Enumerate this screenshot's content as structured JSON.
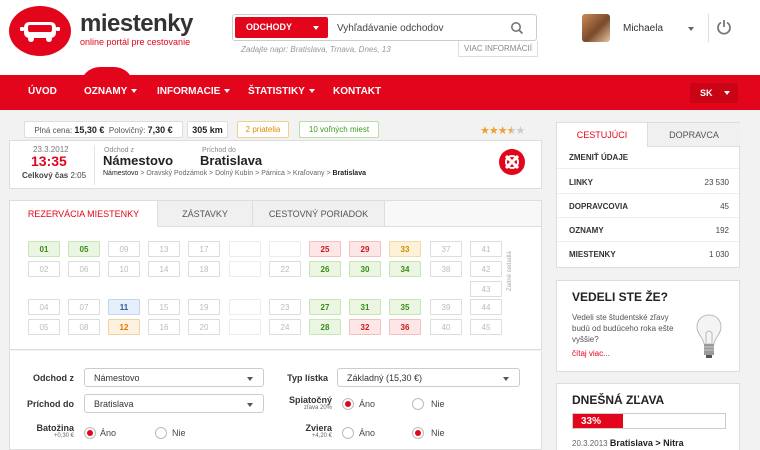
{
  "brand": {
    "name": "miestenky",
    "tagline": "online portál pre cestovanie"
  },
  "search": {
    "mode": "ODCHODY",
    "placeholder": "Vyhľadávanie odchodov",
    "hint": "Zadajte napr: Bratislava, Trnava, Dnes, 13",
    "more_info": "VIAC INFORMÁCIÍ"
  },
  "user": {
    "name": "Michaela"
  },
  "nav": {
    "items": [
      {
        "label": "ÚVOD",
        "dropdown": false
      },
      {
        "label": "OZNAMY",
        "dropdown": true
      },
      {
        "label": "INFORMACIE",
        "dropdown": true
      },
      {
        "label": "ŠTATISTIKY",
        "dropdown": true
      },
      {
        "label": "KONTAKT",
        "dropdown": false
      }
    ],
    "language": "SK"
  },
  "trip": {
    "full_price_label": "Plná cena:",
    "full_price": "15,30 €",
    "half_price_label": "Polovičný:",
    "half_price": "7,30 €",
    "distance": "305 km",
    "friends": "2 priatelia",
    "free_seats": "10 voľných miest",
    "rating": 3.5,
    "date": "23.3.2012",
    "time": "13:35",
    "duration_label": "Celkový čas",
    "duration": "2:05",
    "from_label": "Odchod z",
    "from": "Námestovo",
    "to_label": "Príchod do",
    "to": "Bratislava",
    "route_stops": [
      "Námestovo",
      "Oravský Podzámok",
      "Dolný Kubín",
      "Párnica",
      "Kraľovany"
    ],
    "route_final": "Bratislava"
  },
  "tabs": [
    "REZERVÁCIA MIESTENKY",
    "ZÁSTAVKY",
    "CESTOVNÝ PORIADOK"
  ],
  "seats": {
    "back_label": "Zadné sedadlá",
    "rows": [
      [
        [
          "01",
          "g"
        ],
        [
          "05",
          "g"
        ],
        [
          "09",
          "n"
        ],
        [
          "13",
          "n"
        ],
        [
          "17",
          "n"
        ],
        [
          "",
          ""
        ],
        [
          "",
          ""
        ],
        [
          "25",
          "r"
        ],
        [
          "29",
          "r"
        ],
        [
          "33",
          "y"
        ],
        [
          "37",
          "n"
        ],
        [
          "41",
          "n"
        ]
      ],
      [
        [
          "02",
          "n"
        ],
        [
          "06",
          "n"
        ],
        [
          "10",
          "n"
        ],
        [
          "14",
          "n"
        ],
        [
          "18",
          "n"
        ],
        [
          "",
          ""
        ],
        [
          "22",
          "n"
        ],
        [
          "26",
          "g"
        ],
        [
          "30",
          "g"
        ],
        [
          "34",
          "g"
        ],
        [
          "38",
          "n"
        ],
        [
          "42",
          "n"
        ]
      ],
      [
        [
          "",
          "e"
        ],
        [
          "",
          "e"
        ],
        [
          "",
          "e"
        ],
        [
          "",
          "e"
        ],
        [
          "",
          "e"
        ],
        [
          "",
          "e"
        ],
        [
          "",
          "e"
        ],
        [
          "",
          "e"
        ],
        [
          "",
          "e"
        ],
        [
          "",
          "e"
        ],
        [
          "",
          "e"
        ],
        [
          "43",
          "n"
        ]
      ],
      [
        [
          "04",
          "n"
        ],
        [
          "07",
          "n"
        ],
        [
          "11",
          "b"
        ],
        [
          "15",
          "n"
        ],
        [
          "19",
          "n"
        ],
        [
          "",
          ""
        ],
        [
          "23",
          "n"
        ],
        [
          "27",
          "g"
        ],
        [
          "31",
          "g"
        ],
        [
          "35",
          "g"
        ],
        [
          "39",
          "n"
        ],
        [
          "44",
          "n"
        ]
      ],
      [
        [
          "05",
          "n"
        ],
        [
          "08",
          "n"
        ],
        [
          "12",
          "o"
        ],
        [
          "16",
          "n"
        ],
        [
          "20",
          "n"
        ],
        [
          "",
          ""
        ],
        [
          "24",
          "n"
        ],
        [
          "28",
          "g"
        ],
        [
          "32",
          "r"
        ],
        [
          "36",
          "r"
        ],
        [
          "40",
          "n"
        ],
        [
          "45",
          "n"
        ]
      ]
    ]
  },
  "form": {
    "from_label": "Odchod z",
    "from_value": "Námestovo",
    "to_label": "Príchod do",
    "to_value": "Bratislava",
    "ticket_label": "Typ lístka",
    "ticket_value": "Základný (15,30 €)",
    "student_label": "Spiatočný",
    "student_sub": "zľava 20%",
    "luggage_label": "Batožina",
    "luggage_sub": "+0,30 €",
    "pet_label": "Zviera",
    "pet_sub": "+4,20 €",
    "yes": "Áno",
    "no": "Nie"
  },
  "sidebar": {
    "tabs": [
      "CESTUJÚCI",
      "DOPRAVCA"
    ],
    "stats_title": "ZMENIŤ ÚDAJE",
    "stats": [
      {
        "k": "LINKY",
        "v": "23 530"
      },
      {
        "k": "DOPRAVCOVIA",
        "v": "45"
      },
      {
        "k": "OZNAMY",
        "v": "192"
      },
      {
        "k": "MIESTENKY",
        "v": "1 030"
      }
    ],
    "tip_title": "VEDELI STE ŽE?",
    "tip_text": "Vedeli ste študentské zľavy budú od budúceho roka ešte vyššie?",
    "tip_link": "čítaj viac...",
    "discount_title": "DNEŠNÁ ZĽAVA",
    "discount_percent": "33%",
    "discount_fraction": 0.33,
    "discount_date": "20.3.2013",
    "discount_route": "Bratislava > Nitra"
  },
  "colors": {
    "brand": "#e3051b",
    "green": "#3a8a1a",
    "red": "#c81a1a"
  }
}
